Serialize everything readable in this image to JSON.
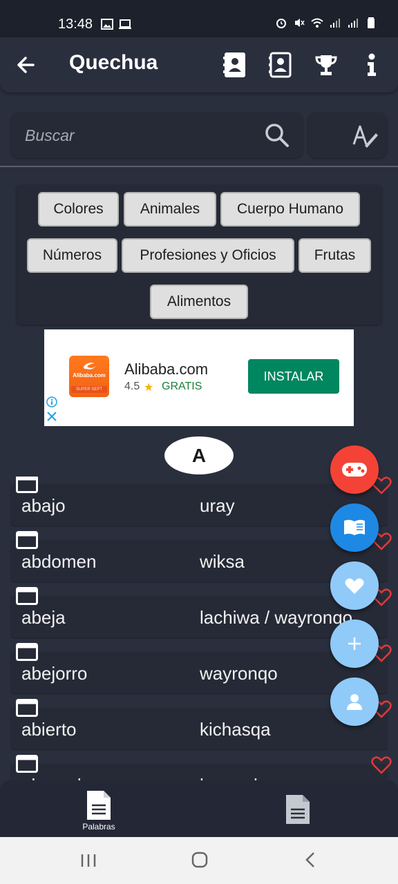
{
  "status_bar": {
    "time": "13:48",
    "left_icons": [
      "image-icon",
      "cast-icon"
    ],
    "right_icons": [
      "alarm-icon",
      "mute-icon",
      "wifi-icon",
      "signal-icon",
      "signal-icon",
      "battery-icon"
    ]
  },
  "app_bar": {
    "title": "Quechua",
    "actions": [
      "contacts-book-icon",
      "contacts-book-outline-icon",
      "trophy-icon",
      "info-icon"
    ]
  },
  "search": {
    "placeholder": "Buscar",
    "value": ""
  },
  "categories": [
    "Colores",
    "Animales",
    "Cuerpo Humano",
    "Números",
    "Profesiones y Oficios",
    "Frutas",
    "Alimentos"
  ],
  "ad": {
    "app_name": "Alibaba.com",
    "logo_text": "Alibaba.com",
    "logo_sub": "SUPER SEPT",
    "rating": "4.5",
    "price": "GRATIS",
    "install_label": "INSTALAR"
  },
  "letter_header": "A",
  "words": [
    {
      "spanish": "abajo",
      "quechua": "uray"
    },
    {
      "spanish": "abdomen",
      "quechua": "wiksa"
    },
    {
      "spanish": "abeja",
      "quechua": "lachiwa / wayronqo"
    },
    {
      "spanish": "abejorro",
      "quechua": "wayronqo"
    },
    {
      "spanish": "abierto",
      "quechua": "kichasqa"
    },
    {
      "spanish": "abogado",
      "quechua": "hamachaq"
    }
  ],
  "fabs": [
    {
      "name": "game-controller-icon",
      "color": "#f44336"
    },
    {
      "name": "book-icon",
      "color": "#1e88e5"
    },
    {
      "name": "heart-icon",
      "color": "#90caf9"
    },
    {
      "name": "plus-icon",
      "color": "#90caf9"
    },
    {
      "name": "person-icon",
      "color": "#90caf9"
    }
  ],
  "bottom_nav": {
    "tab1_label": "Palabras"
  },
  "colors": {
    "background": "#2a2f3e",
    "heart": "#e53935"
  }
}
